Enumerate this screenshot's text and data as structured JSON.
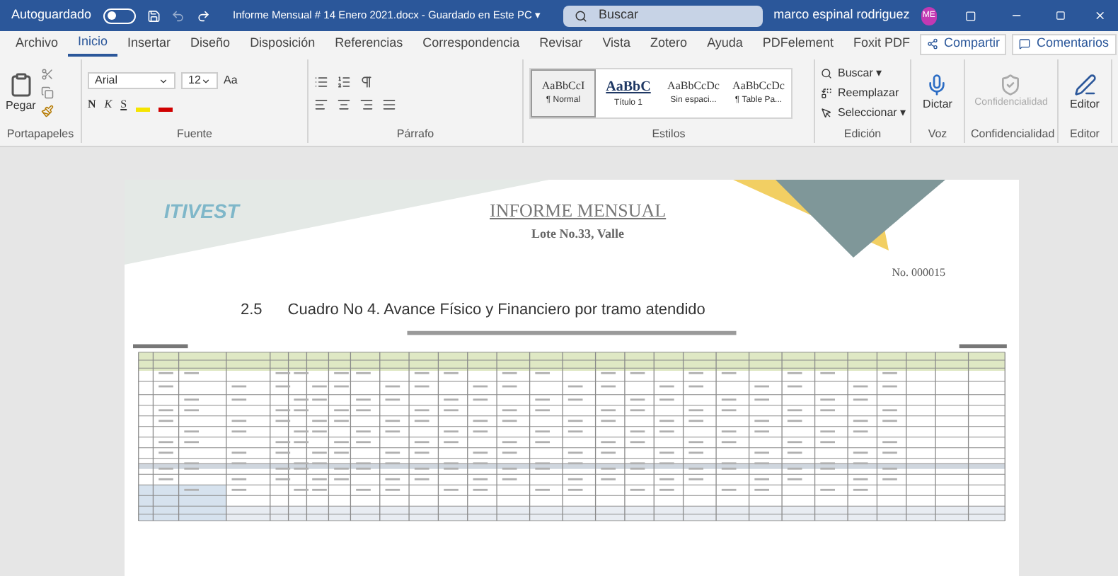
{
  "titlebar": {
    "autosave_label": "Autoguardado",
    "autosave_on": false,
    "title": "Informe Mensual # 14 Enero 2021.docx  -  Guardado en Este PC ▾",
    "search": {
      "placeholder": "Buscar"
    },
    "user": "marco espinal rodriguez",
    "avatar": "ME"
  },
  "tabs": [
    {
      "label": "Archivo",
      "selected": false
    },
    {
      "label": "Inicio",
      "selected": true
    },
    {
      "label": "Insertar",
      "selected": false
    },
    {
      "label": "Diseño",
      "selected": false
    },
    {
      "label": "Disposición",
      "selected": false
    },
    {
      "label": "Referencias",
      "selected": false
    },
    {
      "label": "Correspondencia",
      "selected": false
    },
    {
      "label": "Revisar",
      "selected": false
    },
    {
      "label": "Vista",
      "selected": false
    },
    {
      "label": "Zotero",
      "selected": false
    },
    {
      "label": "Ayuda",
      "selected": false
    },
    {
      "label": "PDFelement",
      "selected": false
    },
    {
      "label": "Foxit PDF",
      "selected": false
    }
  ],
  "share_buttons": [
    "Compartir",
    "Comentarios"
  ],
  "ribbon": {
    "clipboard": {
      "label": "Portapapeles",
      "paste": "Pegar"
    },
    "font": {
      "label": "Fuente",
      "font_name": "Arial",
      "font_size": "12",
      "case": "Aa",
      "bold": "N",
      "italic": "K",
      "underline": "S"
    },
    "paragraph": {
      "label": "Párrafo"
    },
    "styles": {
      "label": "Estilos",
      "items": [
        {
          "sample": "AaBbCcI",
          "name": "¶ Normal",
          "selected": true
        },
        {
          "sample": "AaBbC",
          "name": "Título 1",
          "selected": false
        },
        {
          "sample": "AaBbCcDc",
          "name": "Sin espaci...",
          "selected": false
        },
        {
          "sample": "AaBbCcDc",
          "name": "¶ Table Pa...",
          "selected": false
        }
      ]
    },
    "editing": {
      "label": "Edición",
      "items": [
        "Buscar ▾",
        "Reemplazar",
        "Seleccionar ▾"
      ]
    },
    "voice": {
      "label": "Voz",
      "button": "Dictar"
    },
    "sensitivity": {
      "label": "Confidencialidad",
      "button": "Confidencialidad",
      "disabled": true
    },
    "editor": {
      "label": "Editor",
      "button": "Editor"
    }
  },
  "document": {
    "logo": "ITIVEST",
    "title": "INFORME MENSUAL",
    "subtitle": "Lote No.33, Valle",
    "number": "No. 000015",
    "section_number": "2.5",
    "section_title": "Cuadro No 4. Avance Físico y Financiero por tramo atendido"
  }
}
